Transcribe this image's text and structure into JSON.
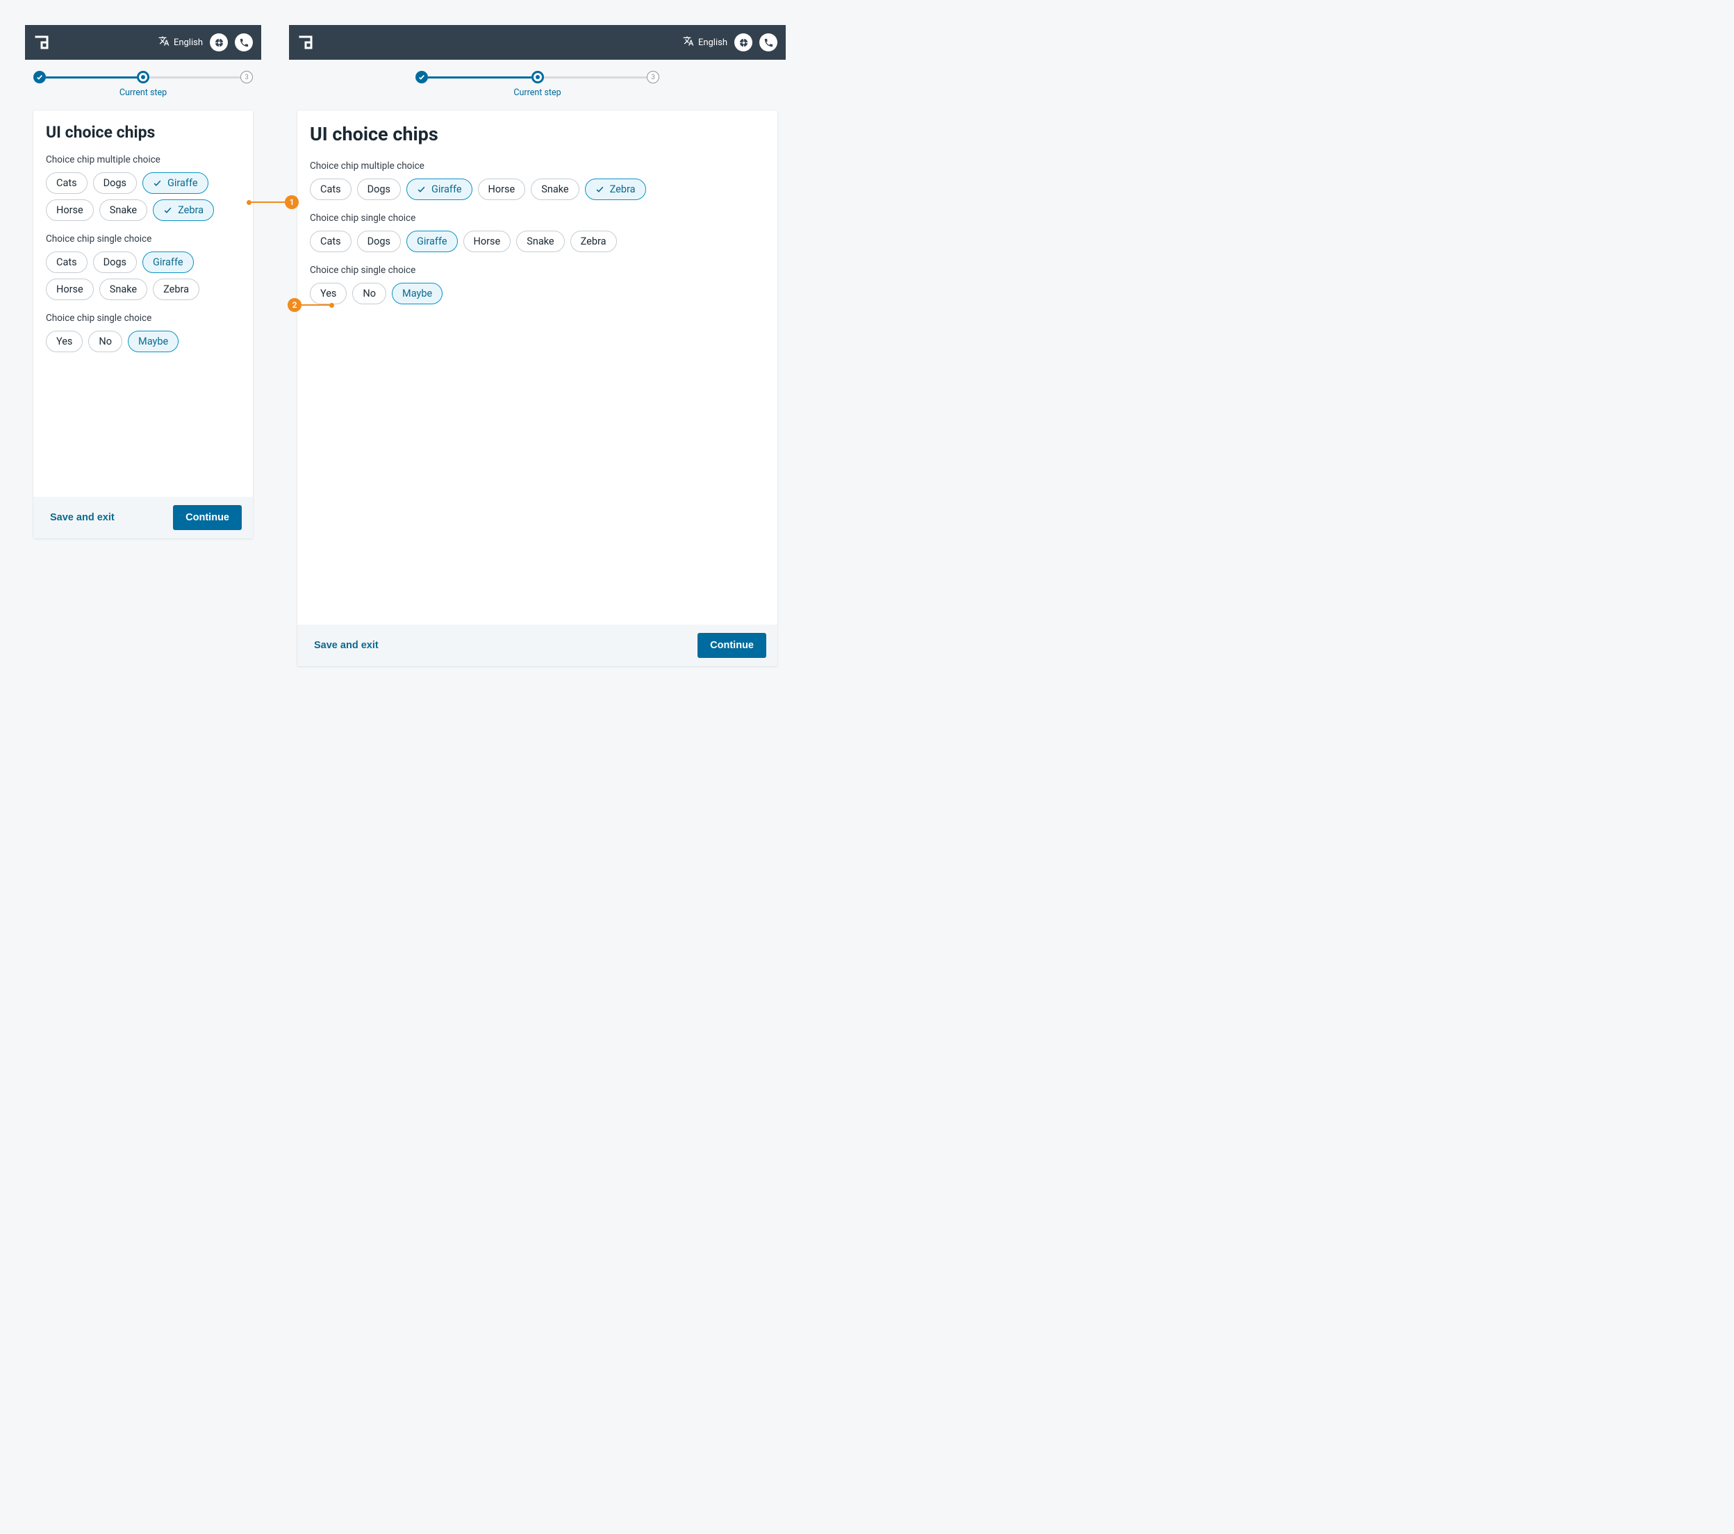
{
  "header": {
    "language_label": "English"
  },
  "stepper": {
    "current_label": "Current step",
    "step3": "3"
  },
  "page_title": "UI choice chips",
  "groups": {
    "multi": {
      "label": "Choice chip multiple choice",
      "options": {
        "cats": "Cats",
        "dogs": "Dogs",
        "giraffe": "Giraffe",
        "horse": "Horse",
        "snake": "Snake",
        "zebra": "Zebra"
      },
      "selected": [
        "giraffe",
        "zebra"
      ]
    },
    "single_animals": {
      "label": "Choice chip single choice",
      "options": {
        "cats": "Cats",
        "dogs": "Dogs",
        "giraffe": "Giraffe",
        "horse": "Horse",
        "snake": "Snake",
        "zebra": "Zebra"
      },
      "selected": "giraffe"
    },
    "single_yesno": {
      "label": "Choice chip single choice",
      "options": {
        "yes": "Yes",
        "no": "No",
        "maybe": "Maybe"
      },
      "selected": "maybe"
    }
  },
  "footer": {
    "save_label": "Save and exit",
    "continue_label": "Continue"
  },
  "annotations": {
    "a1": "1",
    "a2": "2"
  }
}
